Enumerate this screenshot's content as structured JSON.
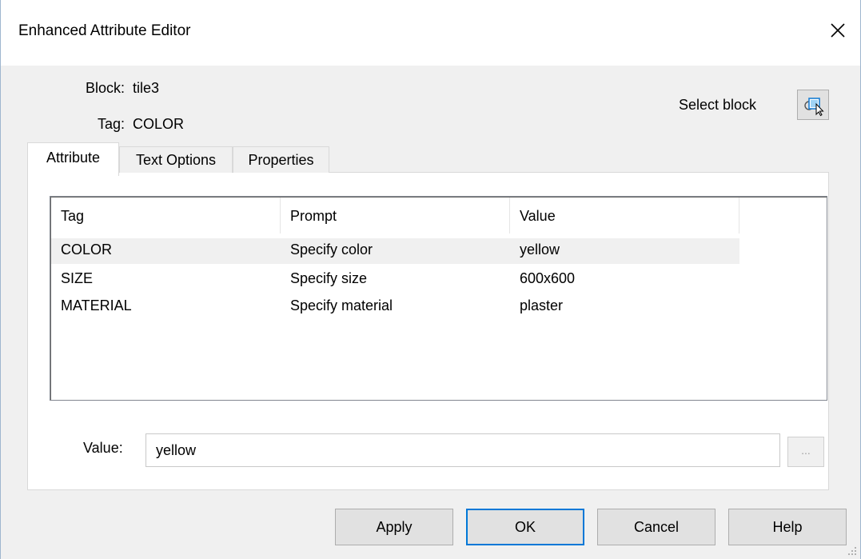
{
  "window": {
    "title": "Enhanced Attribute Editor"
  },
  "info": {
    "block_label": "Block:",
    "block_value": "tile3",
    "tag_label": "Tag:",
    "tag_value": "COLOR",
    "select_block_label": "Select block"
  },
  "tabs": [
    {
      "label": "Attribute",
      "active": true
    },
    {
      "label": "Text Options",
      "active": false
    },
    {
      "label": "Properties",
      "active": false
    }
  ],
  "attribute_list": {
    "columns": [
      "Tag",
      "Prompt",
      "Value"
    ],
    "rows": [
      {
        "tag": "COLOR",
        "prompt": "Specify color",
        "value": "yellow",
        "selected": true
      },
      {
        "tag": "SIZE",
        "prompt": "Specify size",
        "value": "600x600",
        "selected": false
      },
      {
        "tag": "MATERIAL",
        "prompt": "Specify material",
        "value": "plaster",
        "selected": false
      }
    ]
  },
  "value_field": {
    "label": "Value:",
    "value": "yellow",
    "ellipsis_label": "..."
  },
  "buttons": {
    "apply": "Apply",
    "ok": "OK",
    "cancel": "Cancel",
    "help": "Help"
  },
  "colors": {
    "accent": "#0078d7",
    "selected_row": "#f0f0f0"
  }
}
